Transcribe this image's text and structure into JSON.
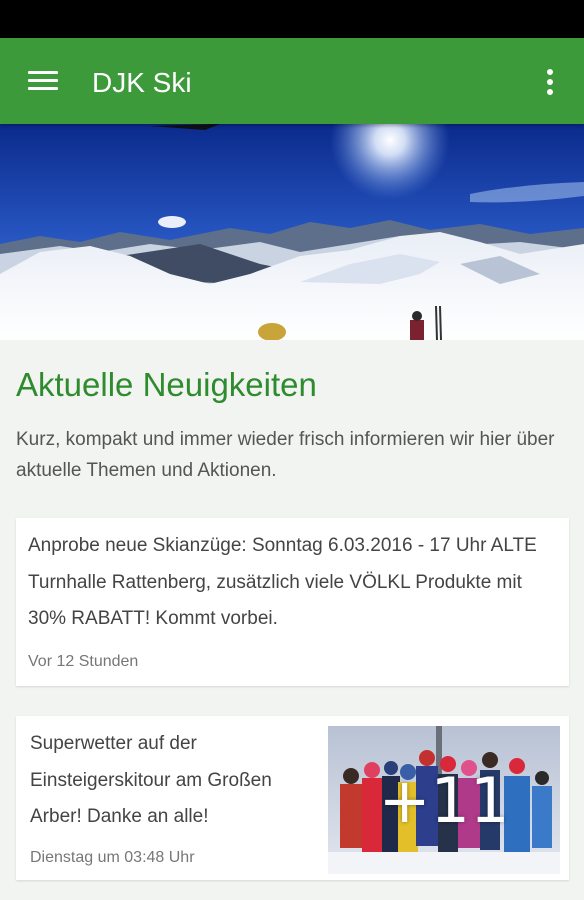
{
  "app_bar": {
    "title": "DJK Ski",
    "menu_icon": "hamburger-menu-icon",
    "overflow_icon": "more-vert-icon",
    "color": "#3d9a3a"
  },
  "section": {
    "title": "Aktuelle Neuigkeiten",
    "description": "Kurz, kompakt und immer wieder frisch informieren wir hier über aktuelle Themen und Aktionen.",
    "title_color": "#2e8b2e"
  },
  "posts": [
    {
      "text": "Anprobe neue Skianzüge: Sonntag 6.03.2016 - 17 Uhr ALTE Turnhalle Rattenberg, zusätzlich viele VÖLKL Produkte mit 30% RABATT! Kommt vorbei.",
      "time": "Vor 12 Stunden"
    },
    {
      "text": "Superwetter auf der Einsteigerskitour am Großen Arber! Danke an alle!",
      "time": "Dienstag um 03:48 Uhr",
      "photo_count": "+11"
    }
  ]
}
